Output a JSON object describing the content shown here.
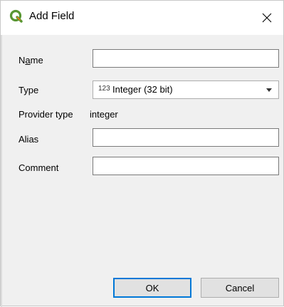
{
  "dialog": {
    "title": "Add Field",
    "close_icon": "close-icon",
    "app_icon": "qgis-icon"
  },
  "form": {
    "name": {
      "label_prefix": "N",
      "label_mnemonic": "a",
      "label_suffix": "me",
      "value": ""
    },
    "type": {
      "label": "Type",
      "prefix": "123",
      "value": "Integer (32 bit)"
    },
    "provider_type": {
      "label": "Provider type",
      "value": "integer"
    },
    "alias": {
      "label": "Alias",
      "value": ""
    },
    "comment": {
      "label": "Comment",
      "value": ""
    }
  },
  "buttons": {
    "ok": "OK",
    "cancel": "Cancel"
  },
  "colors": {
    "accent": "#0078d7",
    "qgis_green": "#589632",
    "qgis_yellow": "#ee7913"
  }
}
